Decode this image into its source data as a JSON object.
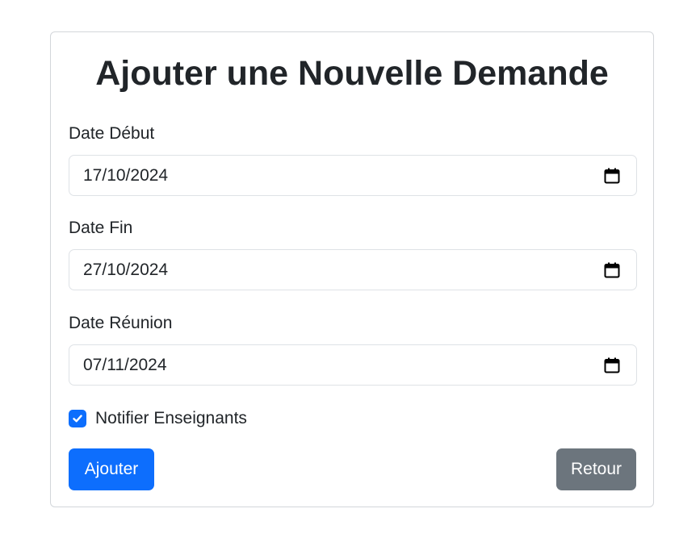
{
  "form": {
    "title": "Ajouter une Nouvelle Demande",
    "fields": [
      {
        "label": "Date Début",
        "value": "17/10/2024",
        "icon": "calendar-icon"
      },
      {
        "label": "Date Fin",
        "value": "27/10/2024",
        "icon": "calendar-icon"
      },
      {
        "label": "Date Réunion",
        "value": "07/11/2024",
        "icon": "calendar-icon"
      }
    ],
    "notify": {
      "label": "Notifier Enseignants",
      "checked": true
    },
    "submit_label": "Ajouter",
    "back_label": "Retour"
  },
  "colors": {
    "primary": "#0d6efd",
    "secondary": "#6c757d",
    "text": "#212529",
    "border": "#dee2e6"
  }
}
